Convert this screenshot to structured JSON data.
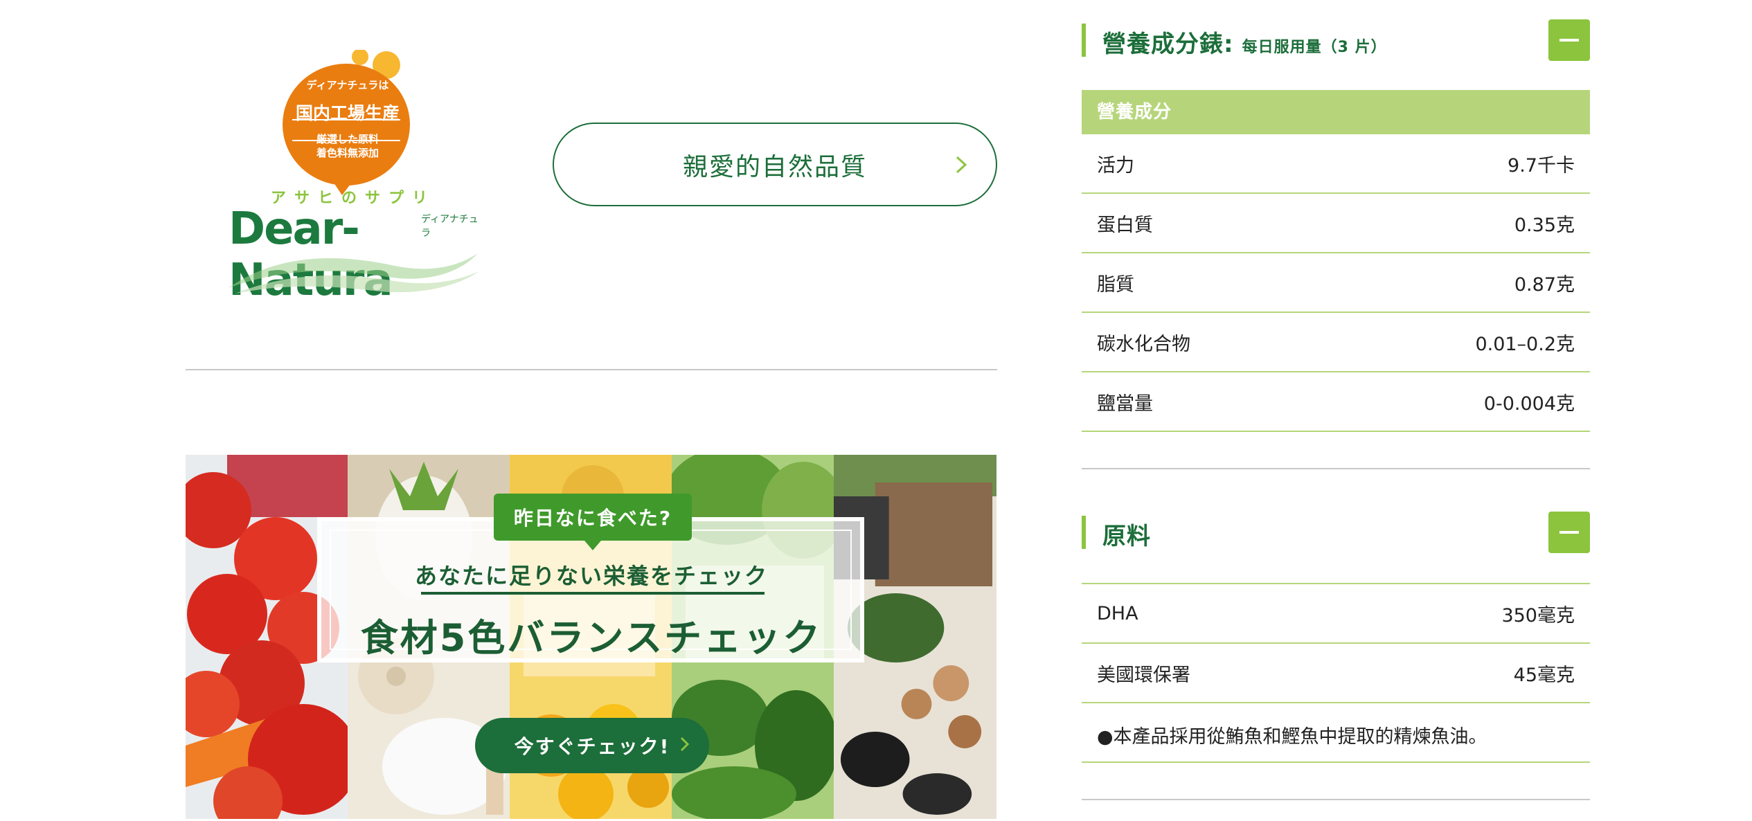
{
  "logo": {
    "bubble_line1": "ディアナチュラは",
    "bubble_line2": "国内工場生産",
    "bubble_line3": "厳選した原料",
    "bubble_line4": "着色料無添加",
    "ruby": "アサヒのサプリ",
    "name": "Dear-Natura",
    "name_ruby": "ディアナチュラ",
    "colors": {
      "orange": "#ea7d10",
      "yellow": "#f7b731",
      "green": "#1c7a3e",
      "lime": "#8cc43e"
    }
  },
  "quality_button": {
    "label": "親愛的自然品質"
  },
  "banner": {
    "tag": "昨日なに食べた?",
    "subtitle": "あなたに足りない栄養をチェック",
    "title": "食材5色バランスチェック",
    "button": "今すぐチェック!"
  },
  "nutrition": {
    "title": "營養成分錶:",
    "note": "每日服用量（3 片）",
    "table_header": "營養成分",
    "rows": [
      {
        "name": "活力",
        "value": "9.7千卡"
      },
      {
        "name": "蛋白質",
        "value": "0.35克"
      },
      {
        "name": "脂質",
        "value": "0.87克"
      },
      {
        "name": "碳水化合物",
        "value": "0.01–0.2克"
      },
      {
        "name": "鹽當量",
        "value": "0-0.004克"
      }
    ]
  },
  "ingredients": {
    "title": "原料",
    "rows": [
      {
        "name": "DHA",
        "value": "350毫克"
      },
      {
        "name": "美國環保署",
        "value": "45毫克"
      }
    ],
    "note": "●本產品採用從鮪魚和鰹魚中提取的精煉魚油。"
  },
  "accent_colors": {
    "dark_green": "#1c6e3a",
    "lime": "#8cc43e",
    "table_header": "#b6d57a"
  }
}
